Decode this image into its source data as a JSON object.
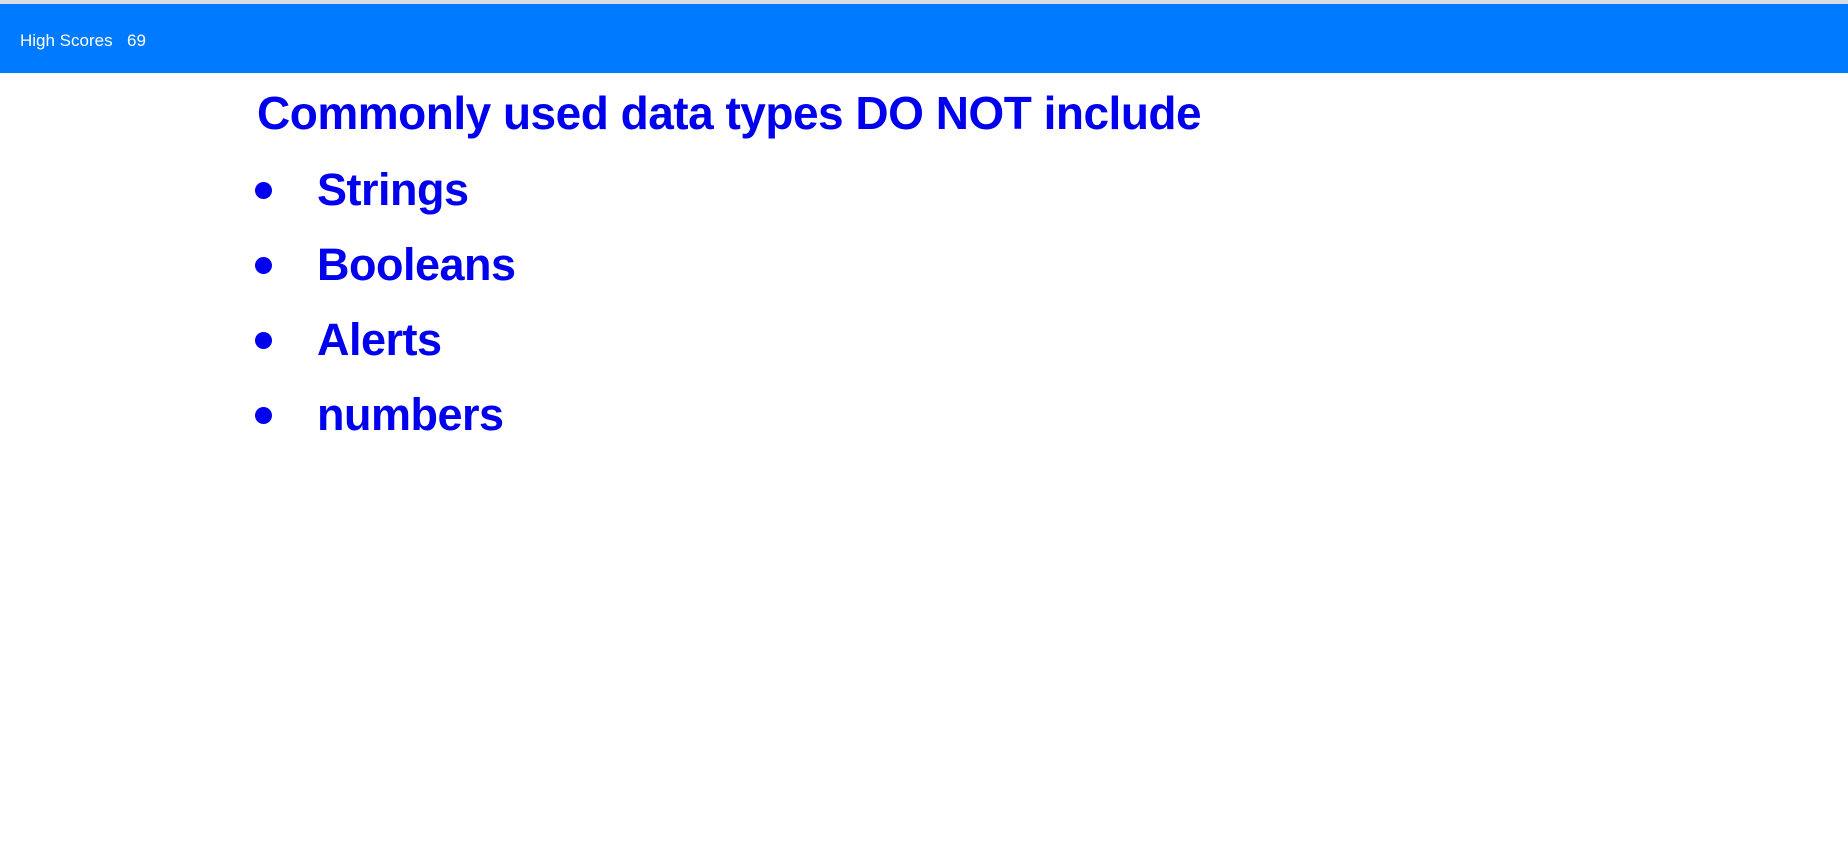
{
  "header": {
    "high_scores_label": "High Scores",
    "score": "69",
    "background_color": "#007bff"
  },
  "quiz": {
    "question": "Commonly used data types DO NOT include",
    "choices": [
      {
        "label": "Strings"
      },
      {
        "label": "Booleans"
      },
      {
        "label": "Alerts"
      },
      {
        "label": "numbers"
      }
    ],
    "text_color": "#0000ee"
  }
}
